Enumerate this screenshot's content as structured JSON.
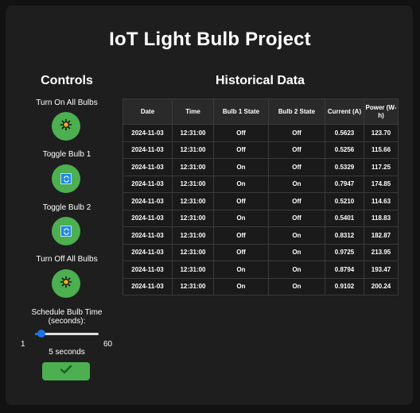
{
  "page": {
    "title": "IoT Light Bulb Project"
  },
  "controls": {
    "heading": "Controls",
    "buttons": [
      {
        "label": "Turn On All Bulbs",
        "icon": "sun-icon"
      },
      {
        "label": "Toggle Bulb 1",
        "icon": "toggle-icon"
      },
      {
        "label": "Toggle Bulb 2",
        "icon": "toggle-icon"
      },
      {
        "label": "Turn Off All Bulbs",
        "icon": "sun-icon"
      }
    ],
    "schedule": {
      "label": "Schedule Bulb Time (seconds):",
      "min": "1",
      "max": "60",
      "value": 5,
      "value_text": "5 seconds",
      "submit_icon": "checkmark-icon"
    }
  },
  "history": {
    "heading": "Historical Data",
    "columns": [
      "Date",
      "Time",
      "Bulb 1 State",
      "Bulb 2 State",
      "Current (A)",
      "Power (W-h)"
    ],
    "rows": [
      [
        "2024-11-03",
        "12:31:00",
        "Off",
        "Off",
        "0.5623",
        "123.70"
      ],
      [
        "2024-11-03",
        "12:31:00",
        "Off",
        "Off",
        "0.5256",
        "115.66"
      ],
      [
        "2024-11-03",
        "12:31:00",
        "On",
        "Off",
        "0.5329",
        "117.25"
      ],
      [
        "2024-11-03",
        "12:31:00",
        "On",
        "On",
        "0.7947",
        "174.85"
      ],
      [
        "2024-11-03",
        "12:31:00",
        "Off",
        "Off",
        "0.5210",
        "114.63"
      ],
      [
        "2024-11-03",
        "12:31:00",
        "On",
        "Off",
        "0.5401",
        "118.83"
      ],
      [
        "2024-11-03",
        "12:31:00",
        "Off",
        "On",
        "0.8312",
        "182.87"
      ],
      [
        "2024-11-03",
        "12:31:00",
        "Off",
        "On",
        "0.9725",
        "213.95"
      ],
      [
        "2024-11-03",
        "12:31:00",
        "On",
        "On",
        "0.8794",
        "193.47"
      ],
      [
        "2024-11-03",
        "12:31:00",
        "On",
        "On",
        "0.9102",
        "200.24"
      ]
    ]
  },
  "colors": {
    "accent_green": "#4caf50",
    "slider_blue": "#1a73e8",
    "background": "#1e1e1e"
  }
}
